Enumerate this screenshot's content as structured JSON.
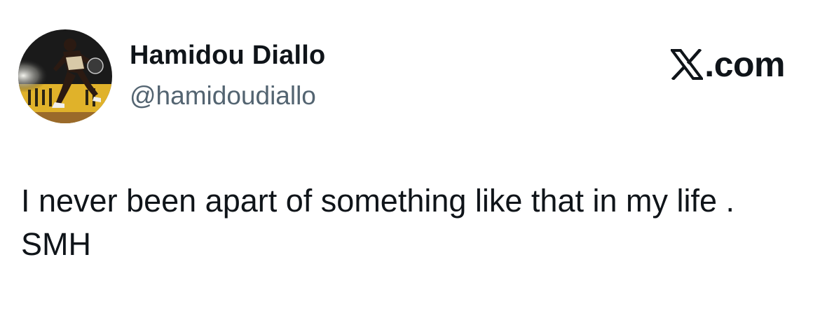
{
  "author": {
    "display_name": "Hamidou Diallo",
    "handle": "@hamidoudiallo",
    "avatar_icon": "player-avatar-icon"
  },
  "brand": {
    "logo_icon": "x-logo-icon",
    "text": ".com"
  },
  "tweet": {
    "text": "I never been apart of something like that in my life . SMH"
  },
  "colors": {
    "text_primary": "#0f1419",
    "text_secondary": "#536471",
    "background": "#ffffff",
    "avatar_yellow": "#e0b22a"
  }
}
